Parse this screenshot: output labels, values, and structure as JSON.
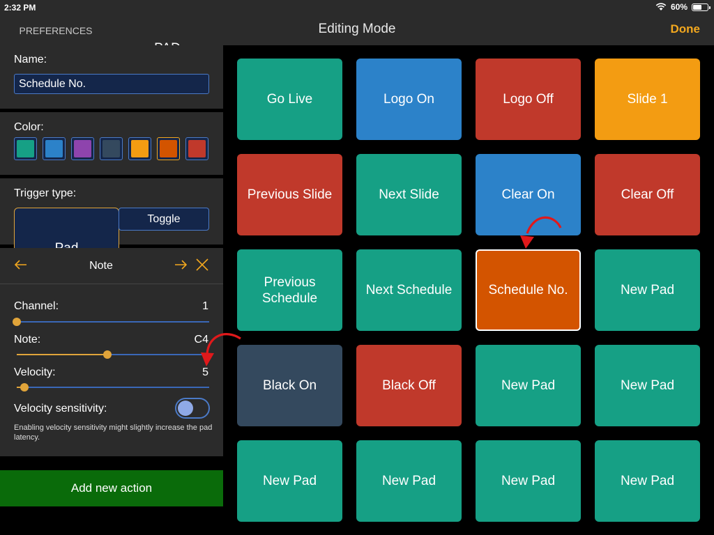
{
  "status": {
    "time": "2:32 PM",
    "battery": "60%",
    "battery_level": 0.6
  },
  "nav": {
    "tabs": [
      "PREFERENCES",
      "PAD EDITOR"
    ],
    "active_tab": "PAD EDITOR",
    "title": "Editing Mode",
    "done_label": "Done"
  },
  "editor": {
    "name_label": "Name:",
    "name_value": "Schedule No.",
    "color_label": "Color:",
    "colors": [
      "#16a085",
      "#2c82c9",
      "#8e44ad",
      "#34495e",
      "#f39c12",
      "#d35400",
      "#c0392b"
    ],
    "selected_color_index": 5,
    "trigger_label": "Trigger type:",
    "trigger_options": [
      "Pad",
      "Toggle"
    ],
    "selected_trigger": "Pad",
    "action": {
      "prev_icon": "arrow-left-icon",
      "next_icon": "arrow-right-icon",
      "close_icon": "close-icon",
      "title": "Note",
      "channel_label": "Channel:",
      "channel_value": "1",
      "channel_level": 0.0,
      "note_label": "Note:",
      "note_value": "C4",
      "note_level": 0.47,
      "velocity_label": "Velocity:",
      "velocity_value": "5",
      "velocity_level": 0.04,
      "sensitivity_label": "Velocity sensitivity:",
      "sensitivity_on": false,
      "sensitivity_hint": "Enabling velocity sensitivity might slightly increase the pad latency."
    },
    "add_action_label": "Add new action"
  },
  "pads": [
    {
      "label": "Go Live",
      "color": "#16a085"
    },
    {
      "label": "Logo On",
      "color": "#2c82c9"
    },
    {
      "label": "Logo Off",
      "color": "#c0392b"
    },
    {
      "label": "Slide 1",
      "color": "#f39c12"
    },
    {
      "label": "Previous Slide",
      "color": "#c0392b"
    },
    {
      "label": "Next Slide",
      "color": "#16a085"
    },
    {
      "label": "Clear On",
      "color": "#2c82c9"
    },
    {
      "label": "Clear Off",
      "color": "#c0392b"
    },
    {
      "label": "Previous Schedule",
      "color": "#16a085"
    },
    {
      "label": "Next Schedule",
      "color": "#16a085"
    },
    {
      "label": "Schedule No.",
      "color": "#d35400",
      "selected": true
    },
    {
      "label": "New Pad",
      "color": "#16a085"
    },
    {
      "label": "Black On",
      "color": "#34495e"
    },
    {
      "label": "Black Off",
      "color": "#c0392b"
    },
    {
      "label": "New Pad",
      "color": "#16a085"
    },
    {
      "label": "New Pad",
      "color": "#16a085"
    },
    {
      "label": "New Pad",
      "color": "#16a085"
    },
    {
      "label": "New Pad",
      "color": "#16a085"
    },
    {
      "label": "New Pad",
      "color": "#16a085"
    },
    {
      "label": "New Pad",
      "color": "#16a085"
    }
  ],
  "annotation_color": "#e0191b"
}
